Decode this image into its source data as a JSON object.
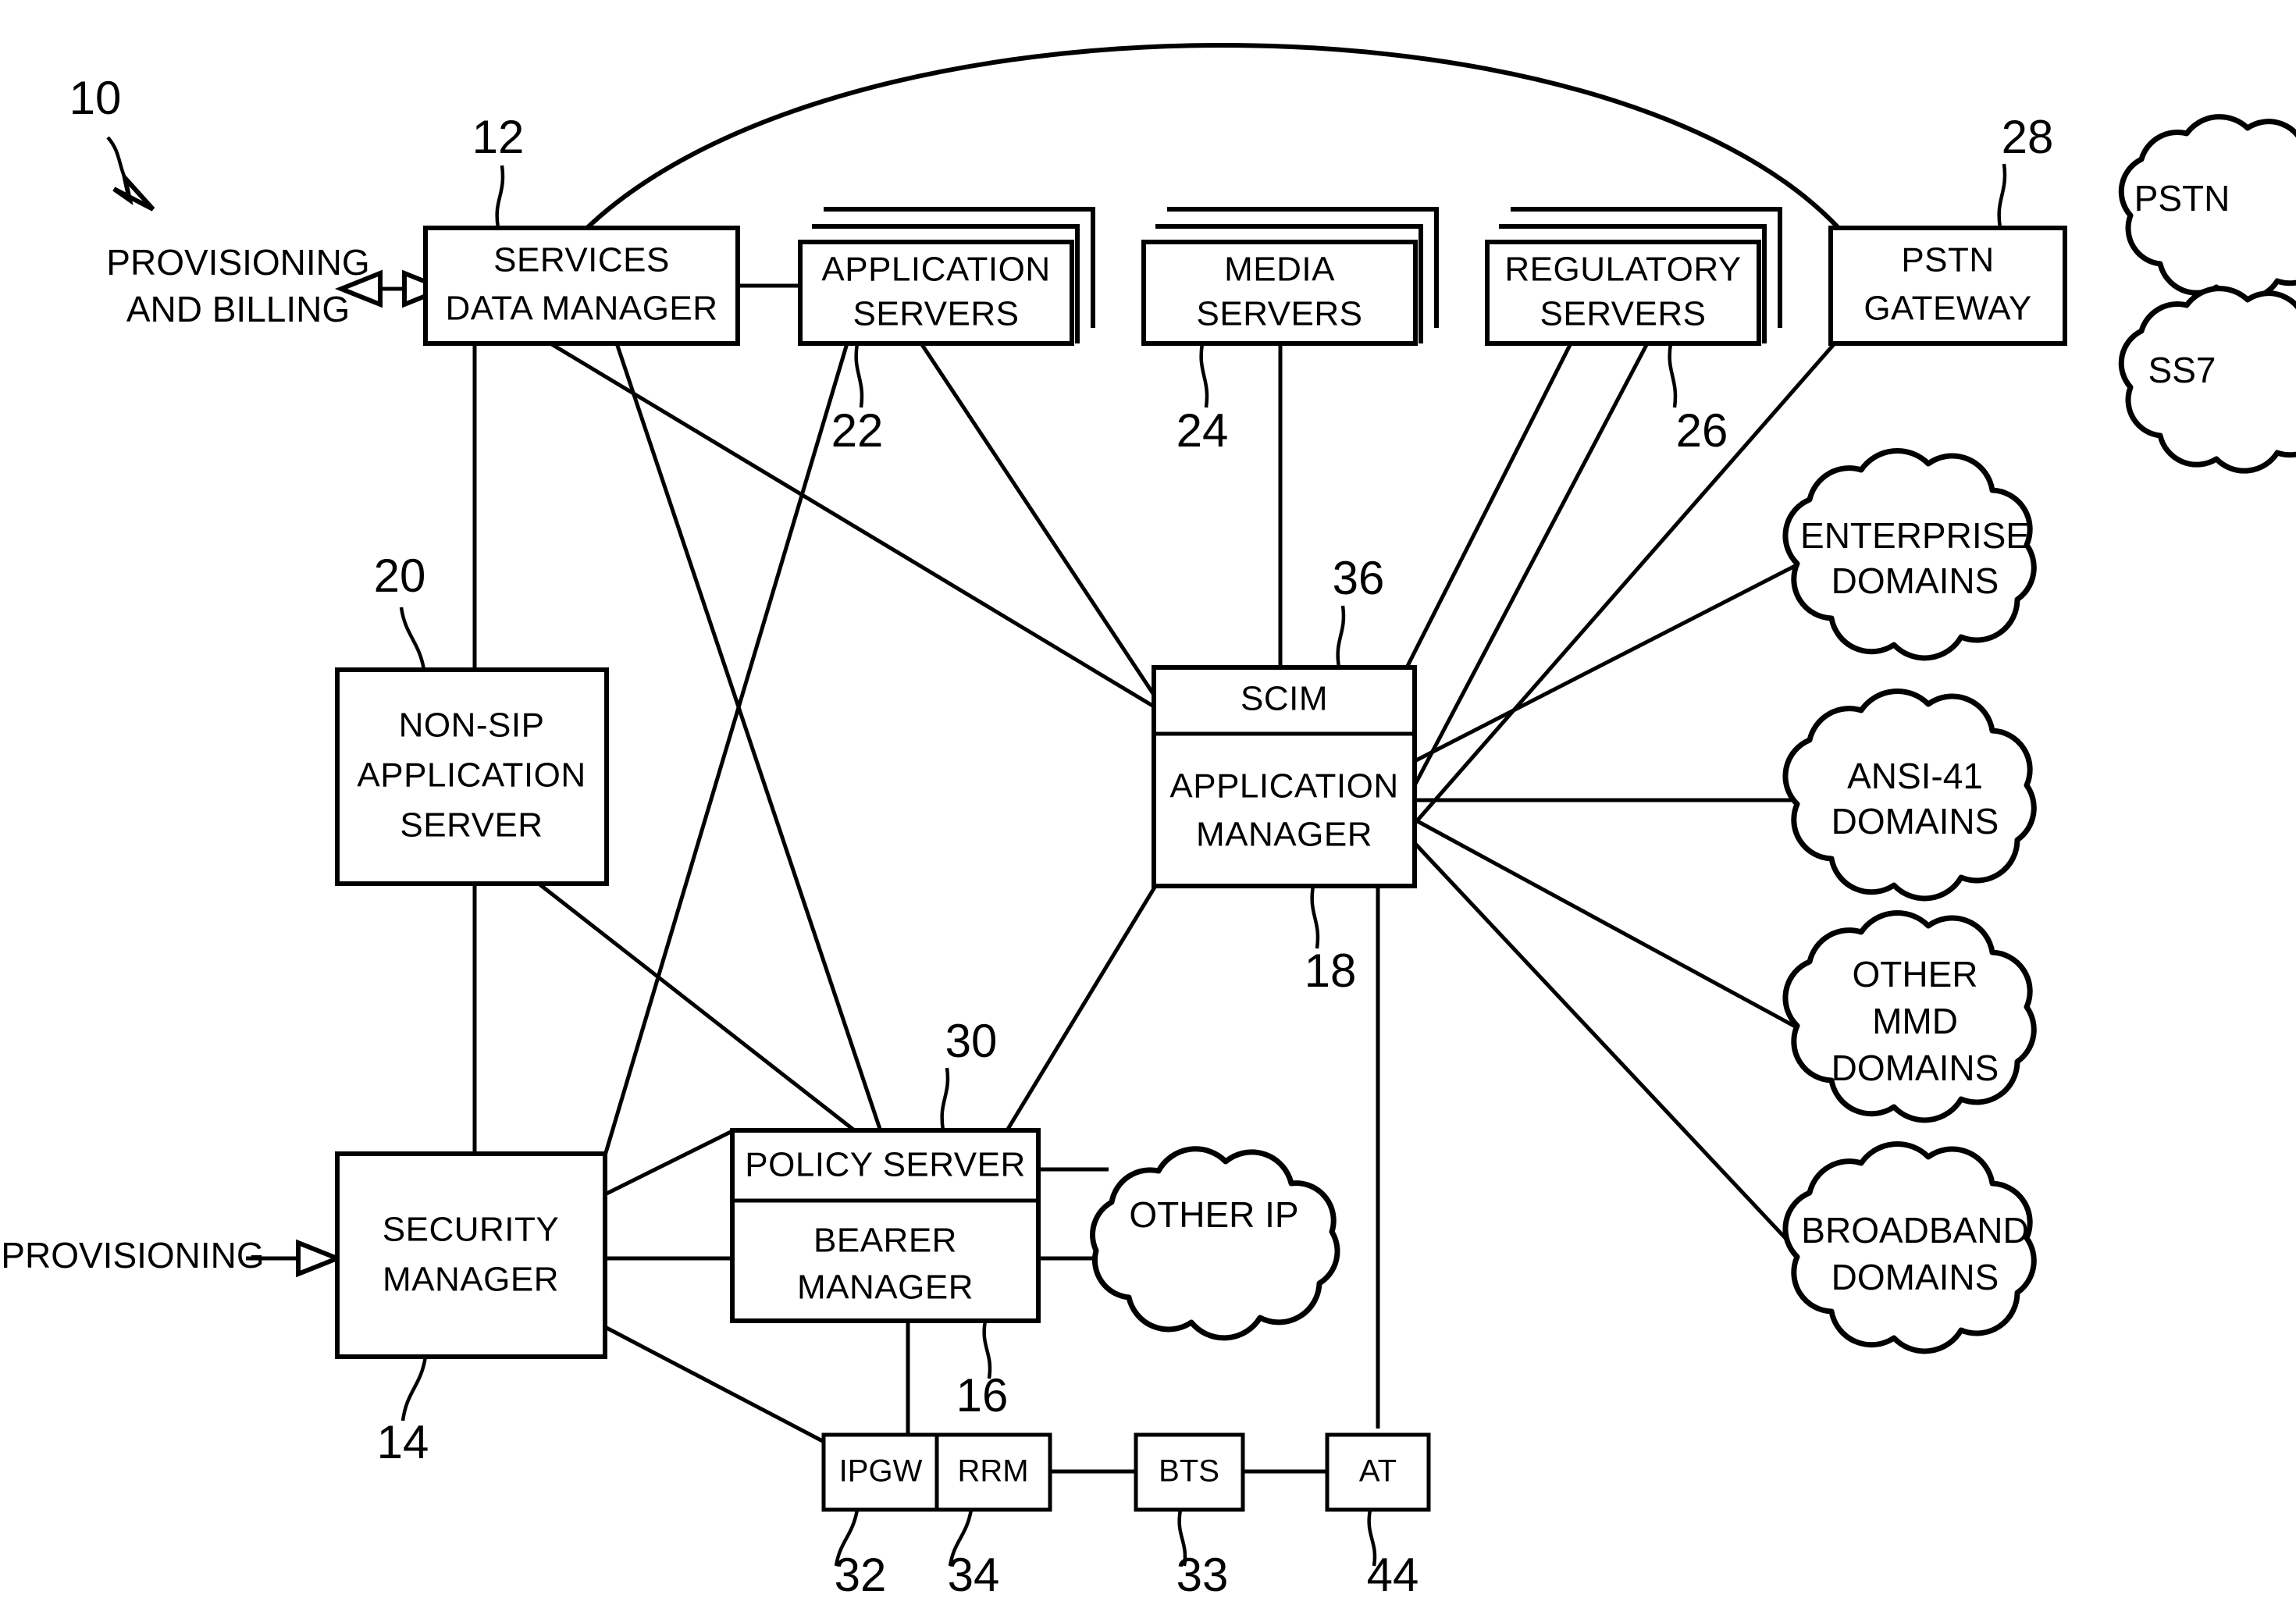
{
  "figure": {
    "ref_numeral": "10",
    "type": "patent-network-architecture-diagram"
  },
  "external_labels": {
    "provisioning_and_billing_line1": "PROVISIONING",
    "provisioning_and_billing_line2": "AND BILLING",
    "provisioning": "PROVISIONING"
  },
  "boxes": {
    "services_data_manager": {
      "line1": "SERVICES",
      "line2": "DATA MANAGER",
      "ref": "12"
    },
    "application_servers": {
      "line1": "APPLICATION",
      "line2": "SERVERS",
      "ref": "22"
    },
    "media_servers": {
      "line1": "MEDIA",
      "line2": "SERVERS",
      "ref": "24"
    },
    "regulatory_servers": {
      "line1": "REGULATORY",
      "line2": "SERVERS",
      "ref": "26"
    },
    "pstn_gateway": {
      "line1": "PSTN",
      "line2": "GATEWAY",
      "ref": "28"
    },
    "non_sip_application_server": {
      "line1": "NON-SIP",
      "line2": "APPLICATION",
      "line3": "SERVER",
      "ref": "20"
    },
    "scim": {
      "line1": "SCIM",
      "ref": "36"
    },
    "application_manager": {
      "line1": "APPLICATION",
      "line2": "MANAGER",
      "ref": "18"
    },
    "security_manager": {
      "line1": "SECURITY",
      "line2": "MANAGER",
      "ref": "14"
    },
    "policy_server": {
      "line1": "POLICY SERVER",
      "ref": "30"
    },
    "bearer_manager": {
      "line1": "BEARER",
      "line2": "MANAGER",
      "ref": "16"
    },
    "ipgw": {
      "line1": "IPGW",
      "ref": "32"
    },
    "rrm": {
      "line1": "RRM",
      "ref": "34"
    },
    "bts": {
      "line1": "BTS",
      "ref": "33"
    },
    "at": {
      "line1": "AT",
      "ref": "44"
    }
  },
  "clouds": {
    "pstn": {
      "line1": "PSTN"
    },
    "ss7": {
      "line1": "SS7"
    },
    "enterprise_domains": {
      "line1": "ENTERPRISE",
      "line2": "DOMAINS"
    },
    "ansi41_domains": {
      "line1": "ANSI-41",
      "line2": "DOMAINS"
    },
    "other_mmd_domains": {
      "line1": "OTHER",
      "line2": "MMD",
      "line3": "DOMAINS"
    },
    "broadband_domains": {
      "line1": "BROADBAND",
      "line2": "DOMAINS"
    },
    "other_ip": {
      "line1": "OTHER IP"
    }
  },
  "colors": {
    "stroke": "#000000",
    "background": "#ffffff"
  }
}
